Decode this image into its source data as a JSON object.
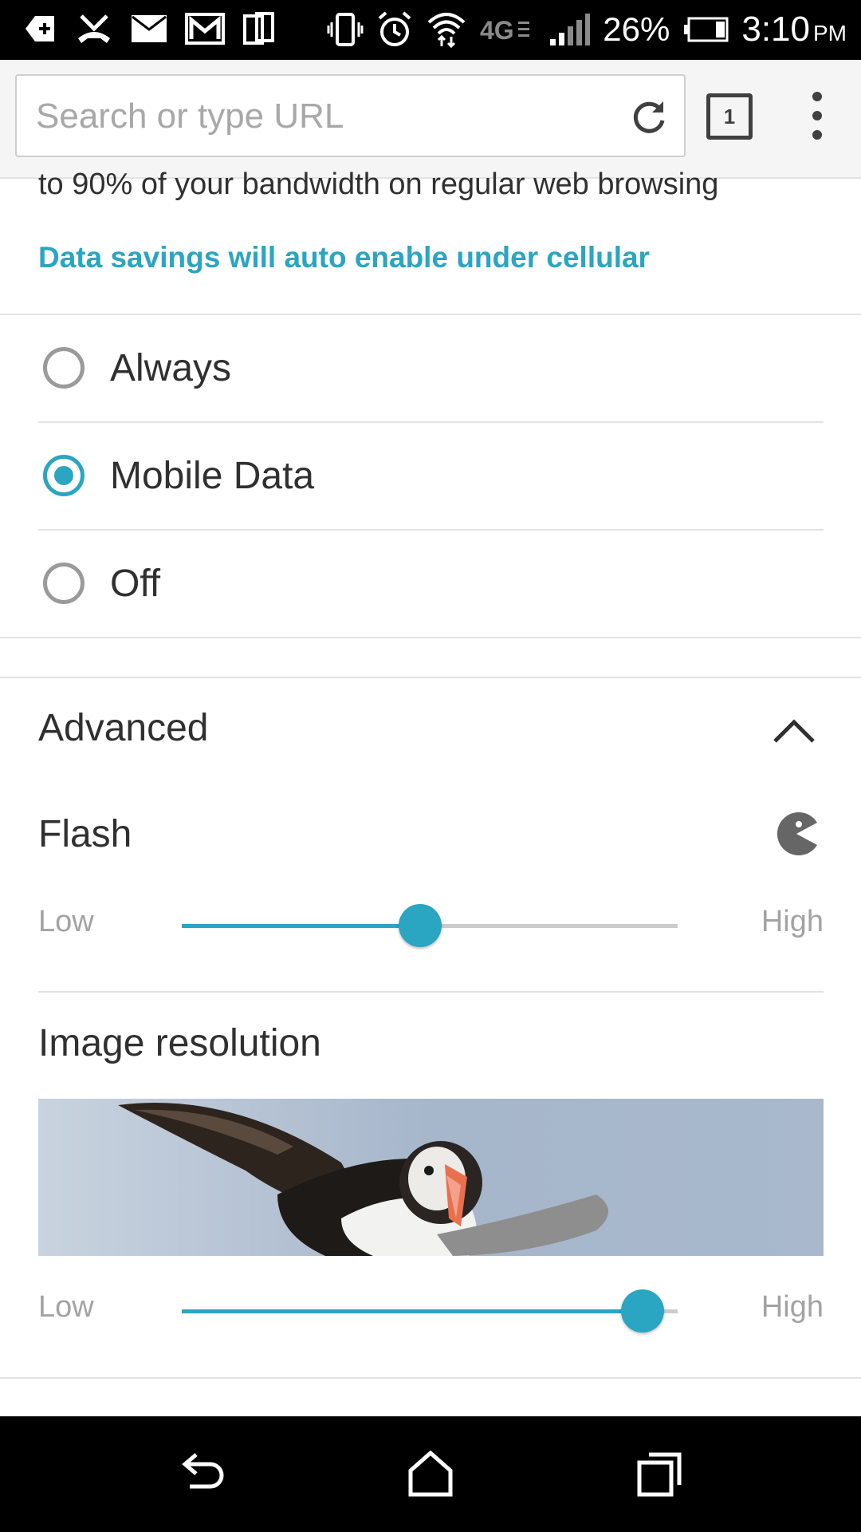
{
  "status_bar": {
    "battery_percent": "26%",
    "time": "3:10",
    "ampm": "PM",
    "network": "4G",
    "icons": [
      "add-icon",
      "missed-call-icon",
      "mail-icon",
      "gmail-icon",
      "multi-window-icon",
      "vibrate-icon",
      "alarm-icon",
      "wifi-icon",
      "network-4g-icon",
      "signal-icon",
      "battery-icon"
    ]
  },
  "toolbar": {
    "search_placeholder": "Search or type URL",
    "search_value": "",
    "tab_count": "1"
  },
  "content": {
    "description": "to 90% of your bandwidth on regular web browsing",
    "auto_note": "Data savings will auto enable under cellular",
    "options": [
      {
        "label": "Always",
        "selected": false
      },
      {
        "label": "Mobile Data",
        "selected": true
      },
      {
        "label": "Off",
        "selected": false
      }
    ],
    "advanced_title": "Advanced",
    "flash": {
      "title": "Flash",
      "low_label": "Low",
      "high_label": "High",
      "level": 0.48
    },
    "image_resolution": {
      "title": "Image resolution",
      "low_label": "Low",
      "high_label": "High",
      "level": 0.93
    }
  },
  "colors": {
    "accent": "#2aa5c2",
    "text": "#303030",
    "muted": "#a3a3a3",
    "status_bar_bg": "#000000"
  }
}
